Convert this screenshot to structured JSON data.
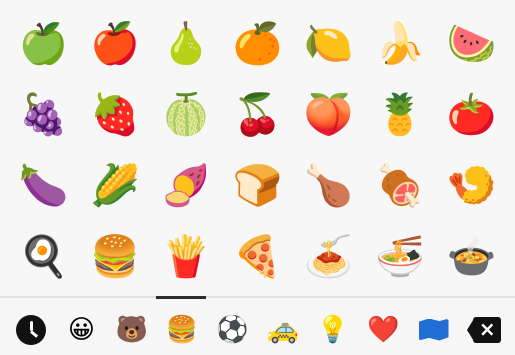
{
  "emoji_grid": [
    "🍏",
    "🍎",
    "🍐",
    "🍊",
    "🍋",
    "🍌",
    "🍉",
    "🍇",
    "🍓",
    "🍈",
    "🍒",
    "🍑",
    "🍍",
    "🍅",
    "🍆",
    "🌽",
    "🍠",
    "🍞",
    "🍗",
    "🍖",
    "🍤",
    "🍳",
    "🍔",
    "🍟",
    "🍕",
    "🍝",
    "🍜",
    "🍲"
  ],
  "categories": {
    "smileys": "😀",
    "animals": "🐻",
    "food": "🍔",
    "activities": "⚽",
    "travel": "🚕",
    "objects": "💡",
    "symbols": "❤️"
  }
}
